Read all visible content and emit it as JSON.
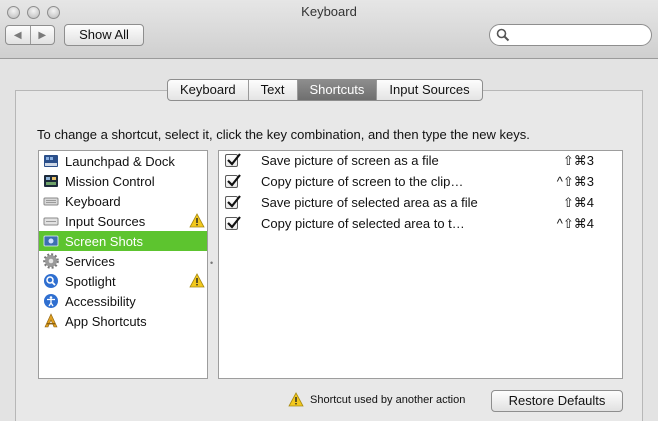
{
  "window": {
    "title": "Keyboard"
  },
  "toolbar": {
    "back_label": "◀",
    "forward_label": "▶",
    "show_all_label": "Show All",
    "search_placeholder": ""
  },
  "tabs": [
    {
      "label": "Keyboard",
      "active": false
    },
    {
      "label": "Text",
      "active": false
    },
    {
      "label": "Shortcuts",
      "active": true
    },
    {
      "label": "Input Sources",
      "active": false
    }
  ],
  "instructions": "To change a shortcut, select it, click the key combination, and then type the new keys.",
  "categories": [
    {
      "label": "Launchpad & Dock",
      "icon": "launchpad-dock-icon",
      "warning": false,
      "selected": false
    },
    {
      "label": "Mission Control",
      "icon": "mission-control-icon",
      "warning": false,
      "selected": false
    },
    {
      "label": "Keyboard",
      "icon": "keyboard-icon",
      "warning": false,
      "selected": false
    },
    {
      "label": "Input Sources",
      "icon": "input-sources-icon",
      "warning": true,
      "selected": false
    },
    {
      "label": "Screen Shots",
      "icon": "screen-shots-icon",
      "warning": false,
      "selected": true
    },
    {
      "label": "Services",
      "icon": "services-gear-icon",
      "warning": false,
      "selected": false
    },
    {
      "label": "Spotlight",
      "icon": "spotlight-icon",
      "warning": true,
      "selected": false
    },
    {
      "label": "Accessibility",
      "icon": "accessibility-icon",
      "warning": false,
      "selected": false
    },
    {
      "label": "App Shortcuts",
      "icon": "app-shortcuts-icon",
      "warning": false,
      "selected": false
    }
  ],
  "shortcuts": [
    {
      "checked": true,
      "label": "Save picture of screen as a file",
      "keys": "⇧⌘3"
    },
    {
      "checked": true,
      "label": "Copy picture of screen to the clip…",
      "keys": "^⇧⌘3"
    },
    {
      "checked": true,
      "label": "Save picture of selected area as a file",
      "keys": "⇧⌘4"
    },
    {
      "checked": true,
      "label": "Copy picture of selected area to t…",
      "keys": "^⇧⌘4"
    }
  ],
  "footer": {
    "legend_text": "Shortcut used by another action",
    "restore_label": "Restore Defaults"
  },
  "colors": {
    "selection": "#5dc42f",
    "warning": "#f2c81e"
  }
}
